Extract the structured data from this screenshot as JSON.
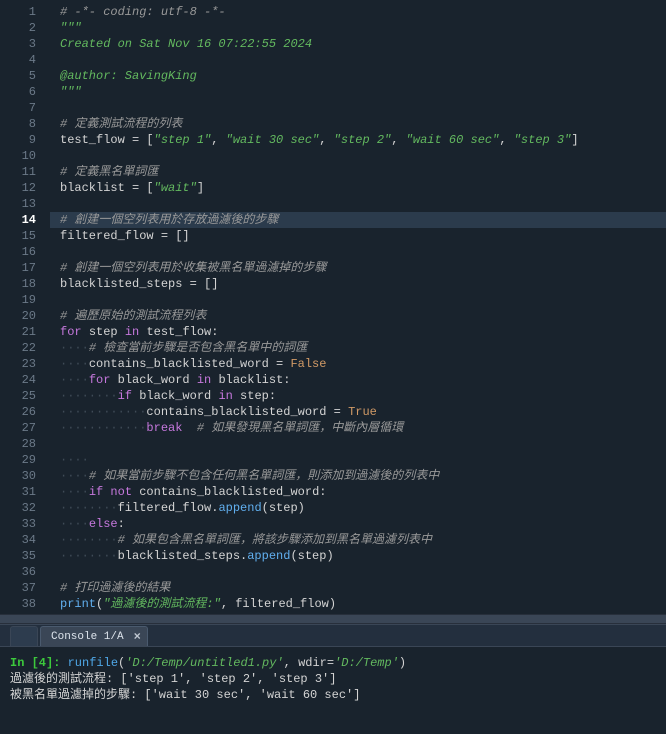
{
  "editor": {
    "highlighted_line": 14,
    "lines": [
      {
        "n": 1,
        "t": [
          [
            "com",
            "# -*- coding: utf-8 -*-"
          ]
        ]
      },
      {
        "n": 2,
        "t": [
          [
            "doc",
            "\"\"\""
          ]
        ]
      },
      {
        "n": 3,
        "t": [
          [
            "doc",
            "Created on Sat Nov 16 07:22:55 2024"
          ]
        ]
      },
      {
        "n": 4,
        "t": [
          [
            "doc",
            ""
          ]
        ]
      },
      {
        "n": 5,
        "t": [
          [
            "doc",
            "@author: SavingKing"
          ]
        ]
      },
      {
        "n": 6,
        "t": [
          [
            "doc",
            "\"\"\""
          ]
        ]
      },
      {
        "n": 7,
        "t": []
      },
      {
        "n": 8,
        "t": [
          [
            "com",
            "# 定義測試流程的列表"
          ]
        ]
      },
      {
        "n": 9,
        "t": [
          [
            "var",
            "test_flow"
          ],
          [
            "op",
            " = ["
          ],
          [
            "str",
            "\"step 1\""
          ],
          [
            "op",
            ", "
          ],
          [
            "str",
            "\"wait 30 sec\""
          ],
          [
            "op",
            ", "
          ],
          [
            "str",
            "\"step 2\""
          ],
          [
            "op",
            ", "
          ],
          [
            "str",
            "\"wait 60 sec\""
          ],
          [
            "op",
            ", "
          ],
          [
            "str",
            "\"step 3\""
          ],
          [
            "op",
            "]"
          ]
        ]
      },
      {
        "n": 10,
        "t": []
      },
      {
        "n": 11,
        "t": [
          [
            "com",
            "# 定義黑名單詞匯"
          ]
        ]
      },
      {
        "n": 12,
        "t": [
          [
            "var",
            "blacklist"
          ],
          [
            "op",
            " = ["
          ],
          [
            "str",
            "\"wait\""
          ],
          [
            "op",
            "]"
          ]
        ]
      },
      {
        "n": 13,
        "t": []
      },
      {
        "n": 14,
        "t": [
          [
            "com",
            "# 創建一個空列表用於存放過濾後的步驟"
          ]
        ]
      },
      {
        "n": 15,
        "t": [
          [
            "var",
            "filtered_flow"
          ],
          [
            "op",
            " = []"
          ]
        ]
      },
      {
        "n": 16,
        "t": []
      },
      {
        "n": 17,
        "t": [
          [
            "com",
            "# 創建一個空列表用於收集被黑名單過濾掉的步驟"
          ]
        ]
      },
      {
        "n": 18,
        "t": [
          [
            "var",
            "blacklisted_steps"
          ],
          [
            "op",
            " = []"
          ]
        ]
      },
      {
        "n": 19,
        "t": []
      },
      {
        "n": 20,
        "t": [
          [
            "com",
            "# 遍歷原始的測試流程列表"
          ]
        ]
      },
      {
        "n": 21,
        "t": [
          [
            "key",
            "for"
          ],
          [
            "op",
            " "
          ],
          [
            "var",
            "step"
          ],
          [
            "op",
            " "
          ],
          [
            "key",
            "in"
          ],
          [
            "op",
            " "
          ],
          [
            "var",
            "test_flow"
          ],
          [
            "op",
            ":"
          ]
        ]
      },
      {
        "n": 22,
        "t": [
          [
            "ws",
            "····"
          ],
          [
            "com",
            "# 檢查當前步驟是否包含黑名單中的詞匯"
          ]
        ]
      },
      {
        "n": 23,
        "t": [
          [
            "ws",
            "····"
          ],
          [
            "var",
            "contains_blacklisted_word"
          ],
          [
            "op",
            " = "
          ],
          [
            "bool",
            "False"
          ]
        ]
      },
      {
        "n": 24,
        "t": [
          [
            "ws",
            "····"
          ],
          [
            "key",
            "for"
          ],
          [
            "op",
            " "
          ],
          [
            "var",
            "black_word"
          ],
          [
            "op",
            " "
          ],
          [
            "key",
            "in"
          ],
          [
            "op",
            " "
          ],
          [
            "var",
            "blacklist"
          ],
          [
            "op",
            ":"
          ]
        ]
      },
      {
        "n": 25,
        "t": [
          [
            "ws",
            "········"
          ],
          [
            "key",
            "if"
          ],
          [
            "op",
            " "
          ],
          [
            "var",
            "black_word"
          ],
          [
            "op",
            " "
          ],
          [
            "key",
            "in"
          ],
          [
            "op",
            " "
          ],
          [
            "var",
            "step"
          ],
          [
            "op",
            ":"
          ]
        ]
      },
      {
        "n": 26,
        "t": [
          [
            "ws",
            "············"
          ],
          [
            "var",
            "contains_blacklisted_word"
          ],
          [
            "op",
            " = "
          ],
          [
            "bool",
            "True"
          ]
        ]
      },
      {
        "n": 27,
        "t": [
          [
            "ws",
            "············"
          ],
          [
            "key",
            "break"
          ],
          [
            "op",
            "  "
          ],
          [
            "com",
            "# 如果發現黑名單詞匯，中斷內層循環"
          ]
        ]
      },
      {
        "n": 28,
        "t": []
      },
      {
        "n": 29,
        "t": [
          [
            "ws",
            "····"
          ]
        ]
      },
      {
        "n": 30,
        "t": [
          [
            "ws",
            "····"
          ],
          [
            "com",
            "# 如果當前步驟不包含任何黑名單詞匯，則添加到過濾後的列表中"
          ]
        ]
      },
      {
        "n": 31,
        "t": [
          [
            "ws",
            "····"
          ],
          [
            "key",
            "if"
          ],
          [
            "op",
            " "
          ],
          [
            "key",
            "not"
          ],
          [
            "op",
            " "
          ],
          [
            "var",
            "contains_blacklisted_word"
          ],
          [
            "op",
            ":"
          ]
        ]
      },
      {
        "n": 32,
        "t": [
          [
            "ws",
            "········"
          ],
          [
            "var",
            "filtered_flow"
          ],
          [
            "op",
            "."
          ],
          [
            "func",
            "append"
          ],
          [
            "op",
            "("
          ],
          [
            "var",
            "step"
          ],
          [
            "op",
            ")"
          ]
        ]
      },
      {
        "n": 33,
        "t": [
          [
            "ws",
            "····"
          ],
          [
            "key",
            "else"
          ],
          [
            "op",
            ":"
          ]
        ]
      },
      {
        "n": 34,
        "t": [
          [
            "ws",
            "········"
          ],
          [
            "com",
            "# 如果包含黑名單詞匯，將該步驟添加到黑名單過濾列表中"
          ]
        ]
      },
      {
        "n": 35,
        "t": [
          [
            "ws",
            "········"
          ],
          [
            "var",
            "blacklisted_steps"
          ],
          [
            "op",
            "."
          ],
          [
            "func",
            "append"
          ],
          [
            "op",
            "("
          ],
          [
            "var",
            "step"
          ],
          [
            "op",
            ")"
          ]
        ]
      },
      {
        "n": 36,
        "t": []
      },
      {
        "n": 37,
        "t": [
          [
            "com",
            "# 打印過濾後的結果"
          ]
        ]
      },
      {
        "n": 38,
        "t": [
          [
            "func",
            "print"
          ],
          [
            "op",
            "("
          ],
          [
            "str",
            "\"過濾後的測試流程:\""
          ],
          [
            "op",
            ", "
          ],
          [
            "var",
            "filtered_flow"
          ],
          [
            "op",
            ")"
          ]
        ]
      }
    ]
  },
  "console": {
    "tab_label": "Console 1/A",
    "prompt_label": "In [4]: ",
    "run_call": "runfile",
    "run_arg1": "'D:/Temp/untitled1.py'",
    "run_kw": ", wdir=",
    "run_arg2": "'D:/Temp'",
    "out1": "過濾後的測試流程: ['step 1', 'step 2', 'step 3']",
    "out2": "被黑名單過濾掉的步驟: ['wait 30 sec', 'wait 60 sec']"
  }
}
